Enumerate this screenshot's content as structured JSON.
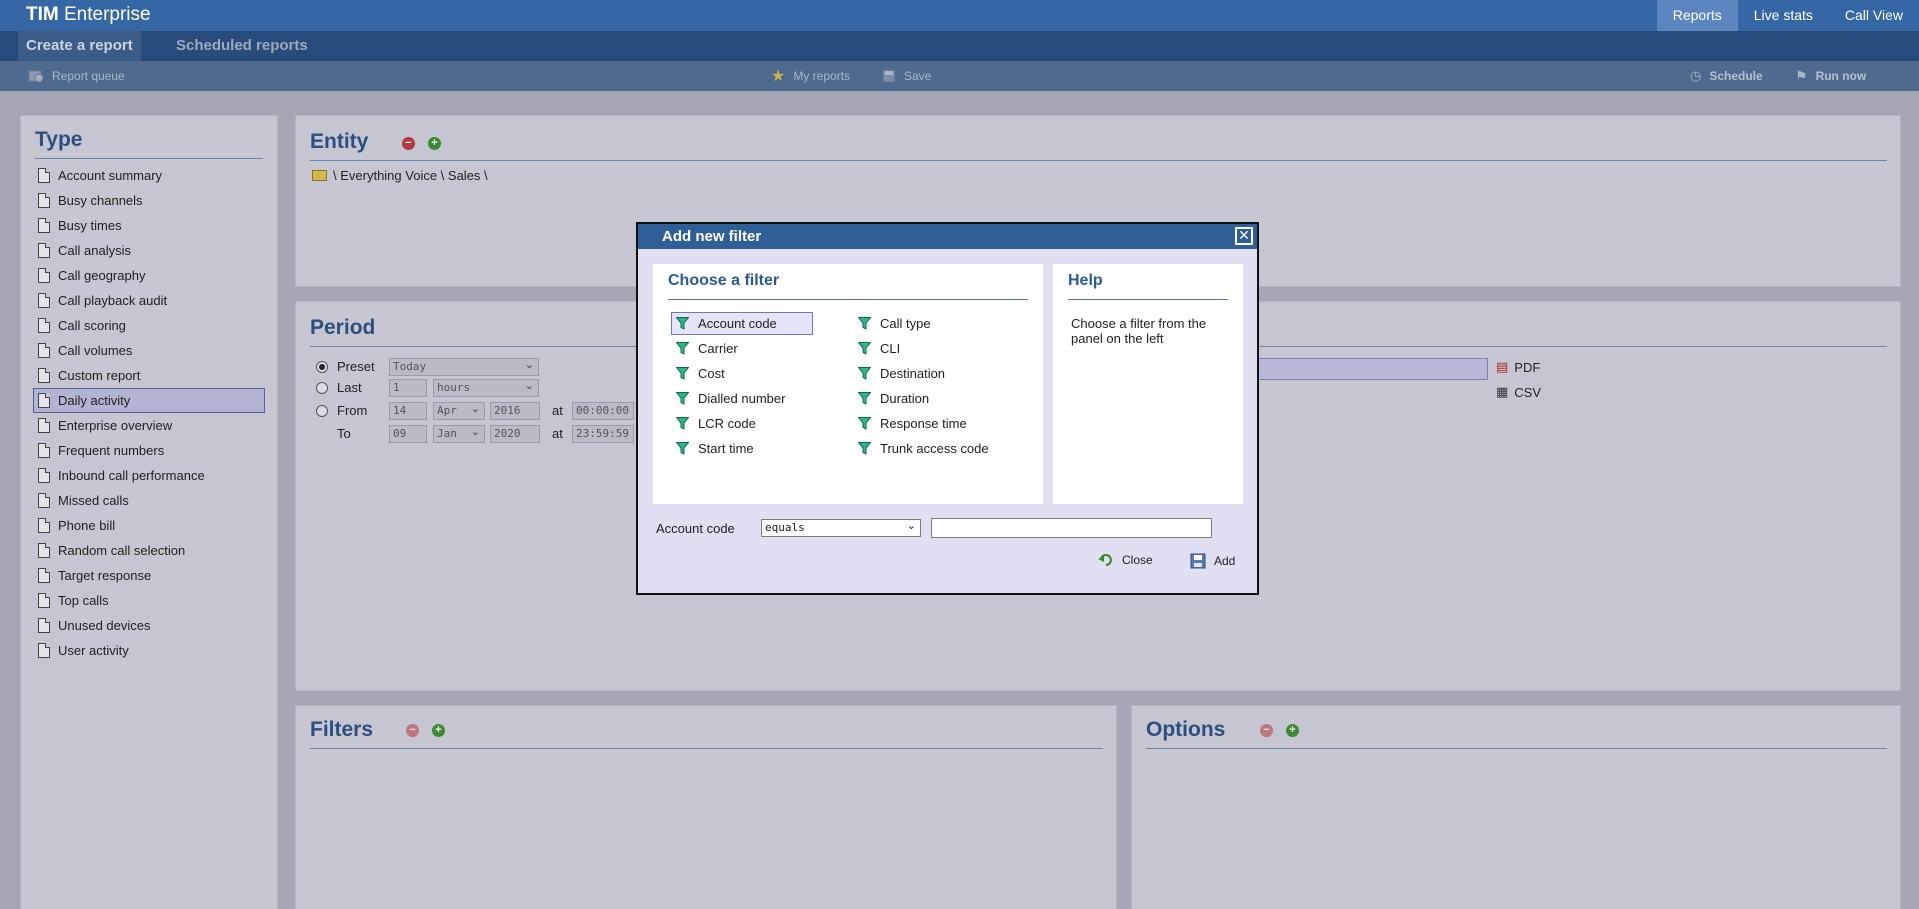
{
  "app": {
    "brand_bold": "TIM",
    "brand_rest": "Enterprise"
  },
  "topnav": [
    {
      "label": "Reports",
      "active": true
    },
    {
      "label": "Live stats"
    },
    {
      "label": "Call View"
    }
  ],
  "tabs": [
    {
      "label": "Create a report",
      "active": true
    },
    {
      "label": "Scheduled reports"
    }
  ],
  "toolbar": {
    "report_queue": "Report queue",
    "my_reports": "My reports",
    "save": "Save",
    "schedule": "Schedule",
    "run_now": "Run now"
  },
  "type_panel": {
    "title": "Type",
    "items": [
      "Account summary",
      "Busy channels",
      "Busy times",
      "Call analysis",
      "Call geography",
      "Call playback audit",
      "Call scoring",
      "Call volumes",
      "Custom report",
      "Daily activity",
      "Enterprise overview",
      "Frequent numbers",
      "Inbound call performance",
      "Missed calls",
      "Phone bill",
      "Random call selection",
      "Target response",
      "Top calls",
      "Unused devices",
      "User activity"
    ],
    "selected": "Daily activity"
  },
  "entity_panel": {
    "title": "Entity",
    "path": "\\ Everything Voice \\ Sales \\"
  },
  "period_panel": {
    "title": "Period",
    "preset_label": "Preset",
    "preset_value": "Today",
    "last_label": "Last",
    "last_value": "1",
    "last_unit": "hours",
    "from_label": "From",
    "from_day": "14",
    "from_month": "Apr",
    "from_year": "2016",
    "at1": "at",
    "from_time": "00:00:00",
    "to_label": "To",
    "to_day": "09",
    "to_month": "Jan",
    "to_year": "2020",
    "at2": "at",
    "to_time": "23:59:59"
  },
  "format": {
    "pdf": "PDF",
    "csv": "CSV"
  },
  "filters_panel": {
    "title": "Filters"
  },
  "options_panel": {
    "title": "Options"
  },
  "dialog": {
    "title": "Add new filter",
    "close_glyph": "✕",
    "choose_title": "Choose a filter",
    "filters_left": [
      "Account code",
      "Carrier",
      "Cost",
      "Dialled number",
      "LCR code",
      "Start time"
    ],
    "filters_right": [
      "Call type",
      "CLI",
      "Destination",
      "Duration",
      "Response time",
      "Trunk access code"
    ],
    "selected": "Account code",
    "help_title": "Help",
    "help_text": "Choose a filter from the panel on the left",
    "field_label": "Account code",
    "operator": "equals",
    "value": "",
    "close_label": "Close",
    "add_label": "Add"
  },
  "colors": {
    "header_blue": "#3667a5",
    "dialog_blue": "#2f5f97",
    "title_blue": "#2c4f7f"
  }
}
